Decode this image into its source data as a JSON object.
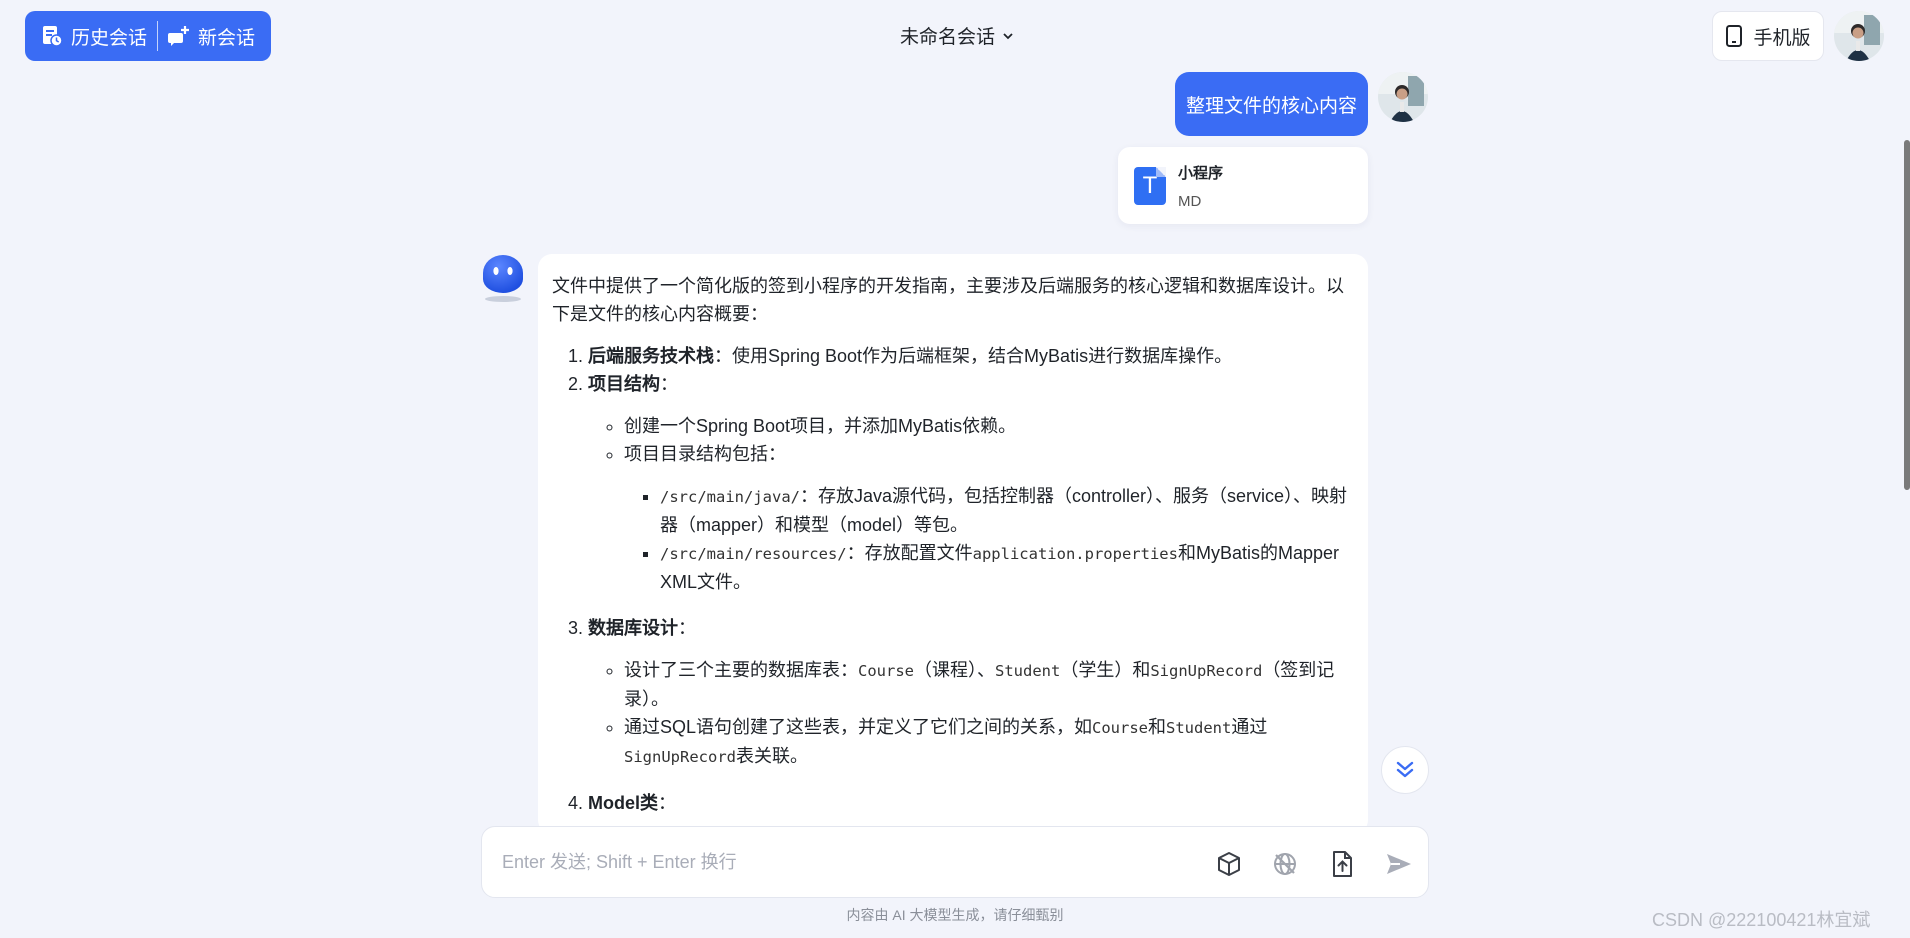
{
  "header": {
    "history_label": "历史会话",
    "new_chat_label": "新会话",
    "conversation_title": "未命名会话",
    "mobile_label": "手机版"
  },
  "user_message": {
    "text": "整理文件的核心内容",
    "file": {
      "name": "小程序",
      "type": "MD",
      "icon_letter": "T"
    }
  },
  "bot_message": {
    "intro": "文件中提供了一个简化版的签到小程序的开发指南，主要涉及后端服务的核心逻辑和数据库设计。以下是文件的核心内容概要：",
    "item1_title": "后端服务技术栈",
    "item1_text": "：使用Spring Boot作为后端框架，结合MyBatis进行数据库操作。",
    "item2_title": "项目结构",
    "item2_colon": "：",
    "item2_bullet1": "创建一个Spring Boot项目，并添加MyBatis依赖。",
    "item2_bullet2": "项目目录结构包括：",
    "dir1_code": "/src/main/java/",
    "dir1_text": "：存放Java源代码，包括控制器（controller）、服务（service）、映射器（mapper）和模型（model）等包。",
    "dir2_code": "/src/main/resources/",
    "dir2_text_a": "：存放配置文件",
    "dir2_code_b": "application.properties",
    "dir2_text_b": "和MyBatis的Mapper XML文件。",
    "item3_title": "数据库设计",
    "item3_colon": "：",
    "db_b1_a": "设计了三个主要的数据库表：",
    "db_b1_code1": "Course",
    "db_b1_b": "（课程）、",
    "db_b1_code2": "Student",
    "db_b1_c": "（学生）和",
    "db_b1_code3": "SignUpRecord",
    "db_b1_d": "（签到记录）。",
    "db_b2_a": "通过SQL语句创建了这些表，并定义了它们之间的关系，如",
    "db_b2_code1": "Course",
    "db_b2_b": "和",
    "db_b2_code2": "Student",
    "db_b2_c": "通过",
    "db_b2_code3": "SignUpRecord",
    "db_b2_d": "表关联。",
    "item4_title": "Model类",
    "item4_colon": "："
  },
  "input": {
    "placeholder": "Enter 发送; Shift + Enter 换行"
  },
  "footer": {
    "disclaimer": "内容由 AI 大模型生成，请仔细甄别",
    "watermark": "CSDN @222100421林宜斌"
  },
  "icons": {
    "history": "history-icon",
    "new_chat": "new-chat-icon",
    "dropdown": "chevron-down-icon",
    "mobile": "phone-icon",
    "cube": "cube-icon",
    "web": "globe-off-icon",
    "upload": "file-upload-icon",
    "send": "send-icon",
    "scroll": "double-chevron-down-icon"
  },
  "colors": {
    "accent": "#3a6cf4",
    "background": "#f2f4fb"
  }
}
